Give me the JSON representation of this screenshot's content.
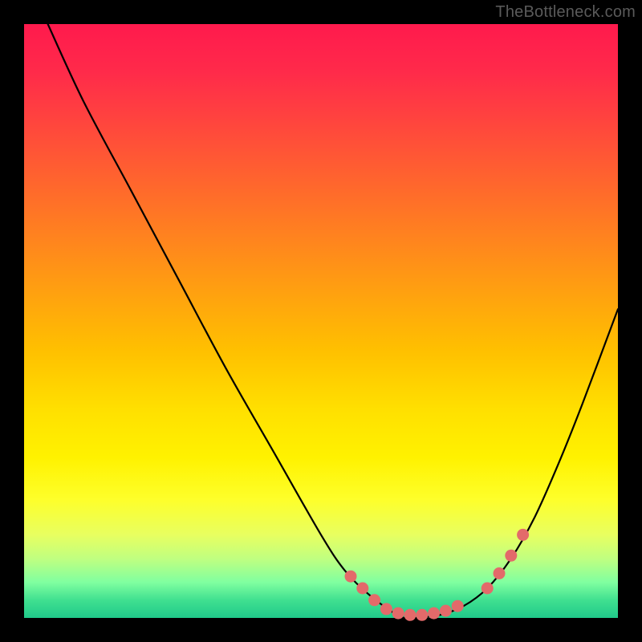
{
  "watermark": "TheBottleneck.com",
  "chart_data": {
    "type": "line",
    "title": "",
    "xlabel": "",
    "ylabel": "",
    "xlim": [
      0,
      100
    ],
    "ylim": [
      0,
      100
    ],
    "grid": false,
    "legend": false,
    "series": [
      {
        "name": "bottleneck-curve",
        "x": [
          4,
          10,
          18,
          26,
          34,
          42,
          50,
          54,
          58,
          62,
          64,
          66,
          70,
          74,
          78,
          82,
          86,
          90,
          94,
          100
        ],
        "values": [
          100,
          87,
          72,
          57,
          42,
          28,
          14,
          8,
          4,
          1,
          0,
          0,
          0.5,
          2,
          5,
          10,
          17,
          26,
          36,
          52
        ]
      }
    ],
    "markers": {
      "name": "highlight-dots",
      "x": [
        55,
        57,
        59,
        61,
        63,
        65,
        67,
        69,
        71,
        73,
        78,
        80,
        82,
        84
      ],
      "values": [
        7,
        5,
        3,
        1.5,
        0.8,
        0.5,
        0.5,
        0.8,
        1.2,
        2,
        5,
        7.5,
        10.5,
        14
      ]
    }
  }
}
